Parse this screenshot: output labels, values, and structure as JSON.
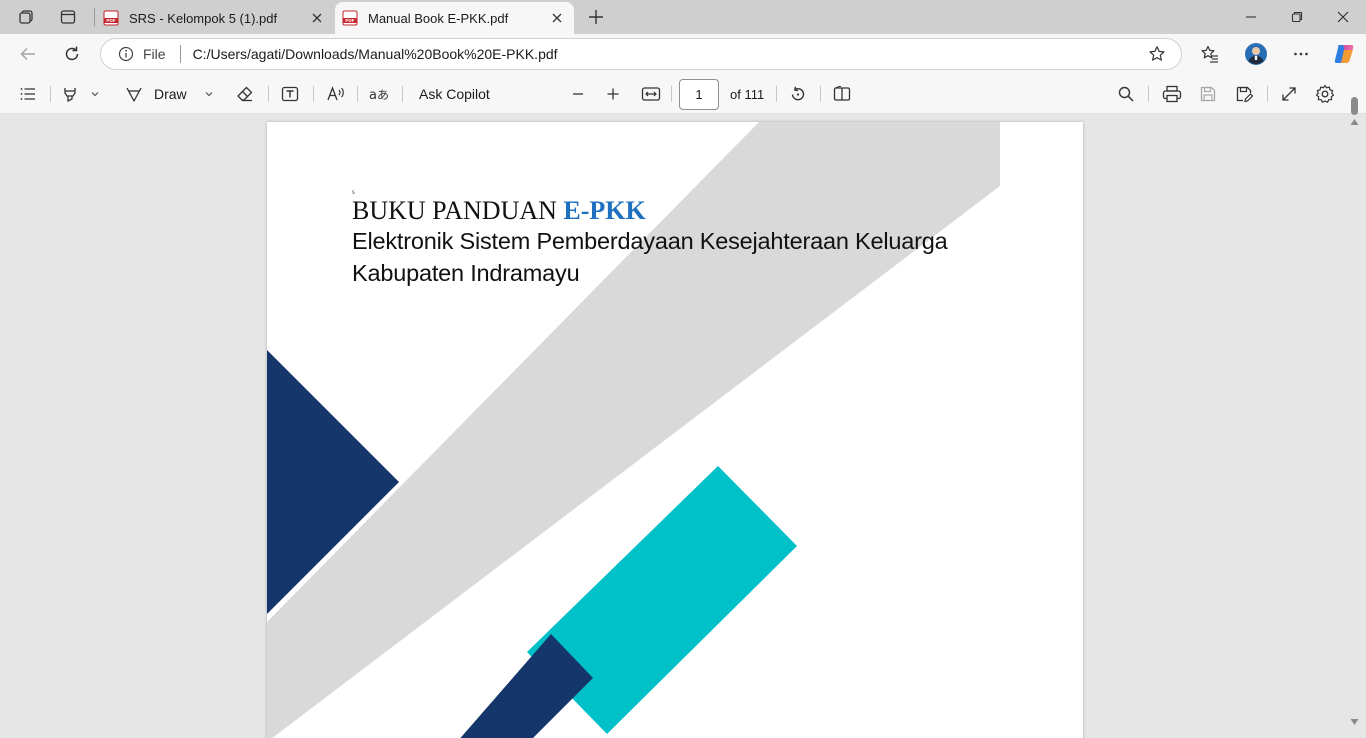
{
  "browser": {
    "tabs": [
      {
        "title": "SRS - Kelompok 5 (1).pdf",
        "icon": "pdf-icon",
        "active": false
      },
      {
        "title": "Manual Book E-PKK.pdf",
        "icon": "pdf-icon",
        "active": true
      }
    ],
    "address": {
      "scheme_label": "File",
      "url": "C:/Users/agati/Downloads/Manual%20Book%20E-PKK.pdf"
    }
  },
  "pdf_toolbar": {
    "draw_label": "Draw",
    "ask_copilot_label": "Ask Copilot",
    "page_current": "1",
    "page_total_label": "of 111"
  },
  "document": {
    "stray_mark": "s",
    "title_plain": "BUKU PANDUAN ",
    "title_accent": "E-PKK",
    "subtitle_line1": "Elektronik Sistem Pemberdayaan Kesejahteraan Keluarga",
    "subtitle_line2": "Kabupaten Indramayu"
  },
  "colors": {
    "accent_blue": "#1f70c1",
    "navy": "#15366a",
    "teal": "#00c0c8",
    "light_gray_band": "#d9d9d9"
  }
}
